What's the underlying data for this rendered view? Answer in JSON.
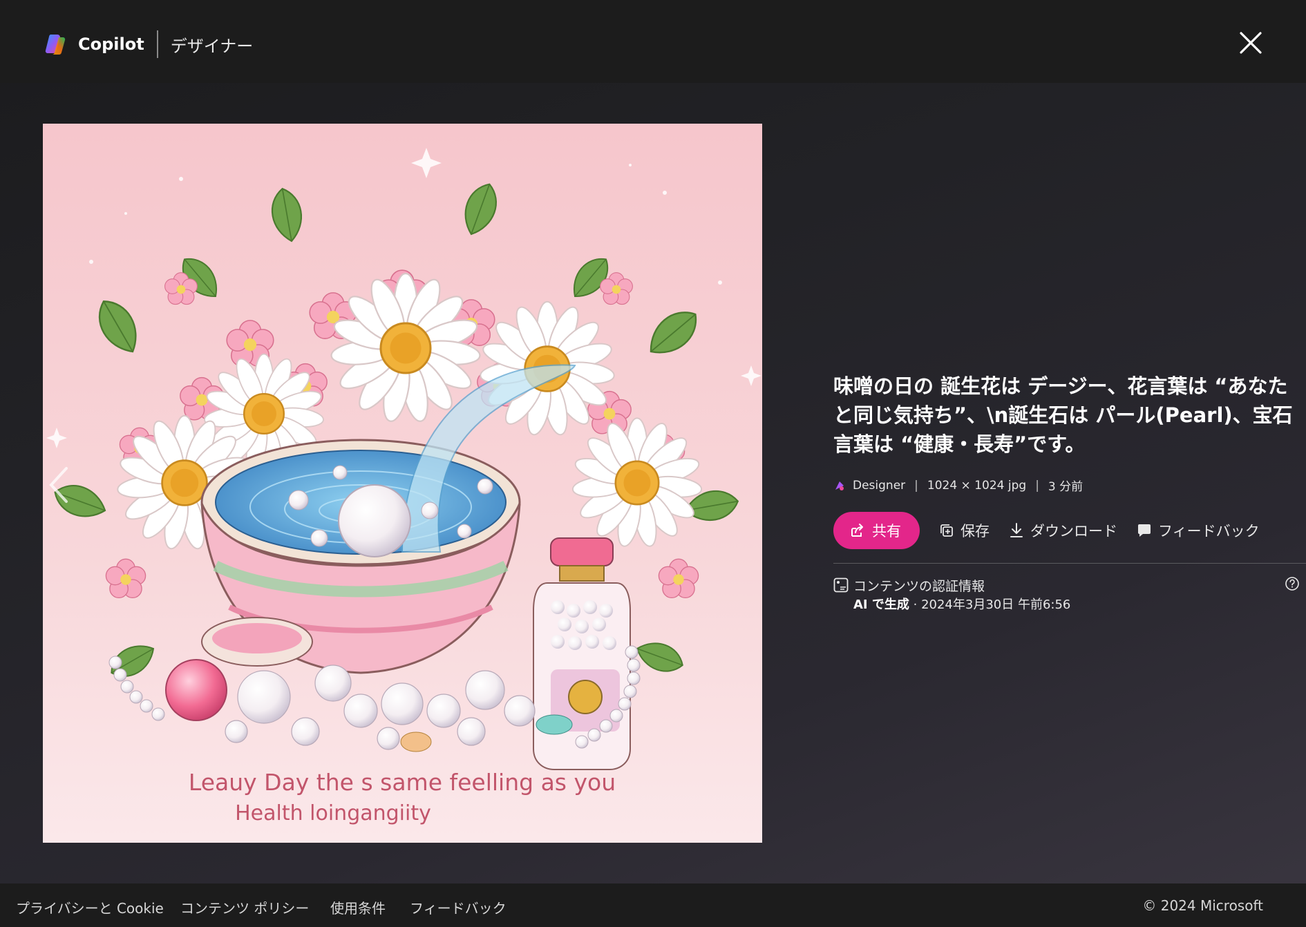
{
  "header": {
    "brand_name": "Copilot",
    "product": "デザイナー",
    "close_icon": "close-icon"
  },
  "image": {
    "caption_line1": "Leauy Day the s same feelling as you",
    "caption_line2": "Health loingangiity",
    "background_color": "#f7d3d6"
  },
  "info": {
    "title": "味噌の日の 誕生花は デージー、花言葉は “あなたと同じ気持ち”、\\n誕生石は パール(Pearl)、宝石言葉は “健康・長寿”です。",
    "meta": {
      "source": "Designer",
      "dimensions": "1024 × 1024 jpg",
      "time": "3 分前"
    },
    "actions": {
      "share": "共有",
      "save": "保存",
      "download": "ダウンロード",
      "feedback": "フィードバック"
    },
    "credentials": {
      "title": "コンテンツの認証情報",
      "ai_label": "AI で生成",
      "date": " · 2024年3月30日 午前6:56"
    }
  },
  "footer": {
    "links": [
      "プライバシーと Cookie",
      "コンテンツ ポリシー",
      "使用条件",
      "フィードバック"
    ],
    "copyright": "© 2024 Microsoft"
  },
  "colors": {
    "accent": "#e3268a",
    "header_bg": "#1c1c1c"
  }
}
